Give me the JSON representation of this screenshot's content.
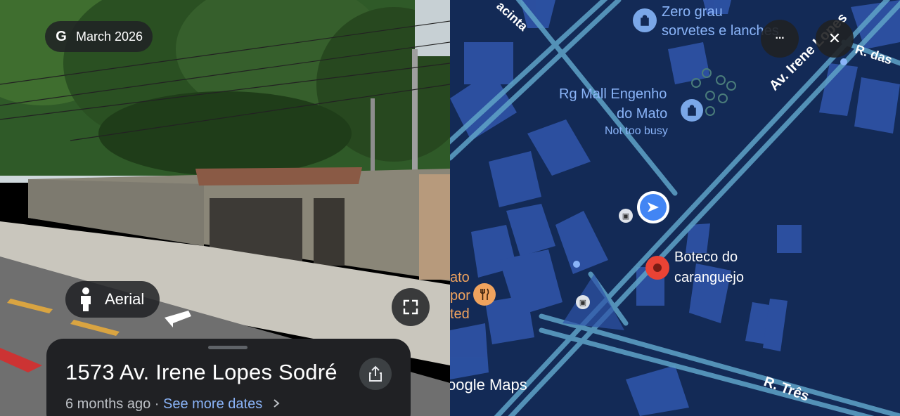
{
  "street_view": {
    "date_label": "March 2026",
    "mode_label": "Aerial",
    "address": "1573 Av. Irene Lopes Sodré",
    "age": "6 months ago",
    "separator": "·",
    "see_more": "See more dates",
    "icons": [
      "google-g-icon",
      "person-icon",
      "expand-icon",
      "share-icon",
      "chevron-right-icon"
    ]
  },
  "map": {
    "places": {
      "zero_grau_1": "Zero grau",
      "zero_grau_2": "sorvetes e lanches",
      "rg_mall_1": "Rg Mall Engenho",
      "rg_mall_2": "do Mato",
      "rg_mall_status": "Not too busy",
      "boteco_1": "Boteco do",
      "boteco_2": "caranguejo",
      "partial_1": "ato",
      "partial_2": "por",
      "partial_3": "ted"
    },
    "streets": {
      "irene": "Av. Irene Lopes",
      "das": "R. das",
      "jacinta": "acinta",
      "tres": "R. Três"
    },
    "watermark": "oogle Maps",
    "buttons": {
      "more": "···",
      "close": "✕"
    },
    "colors": {
      "background": "#132a56",
      "road": "#5fa3c8",
      "building": "#2f54a8",
      "accent": "#4285f4",
      "pin": "#ea4335"
    }
  }
}
